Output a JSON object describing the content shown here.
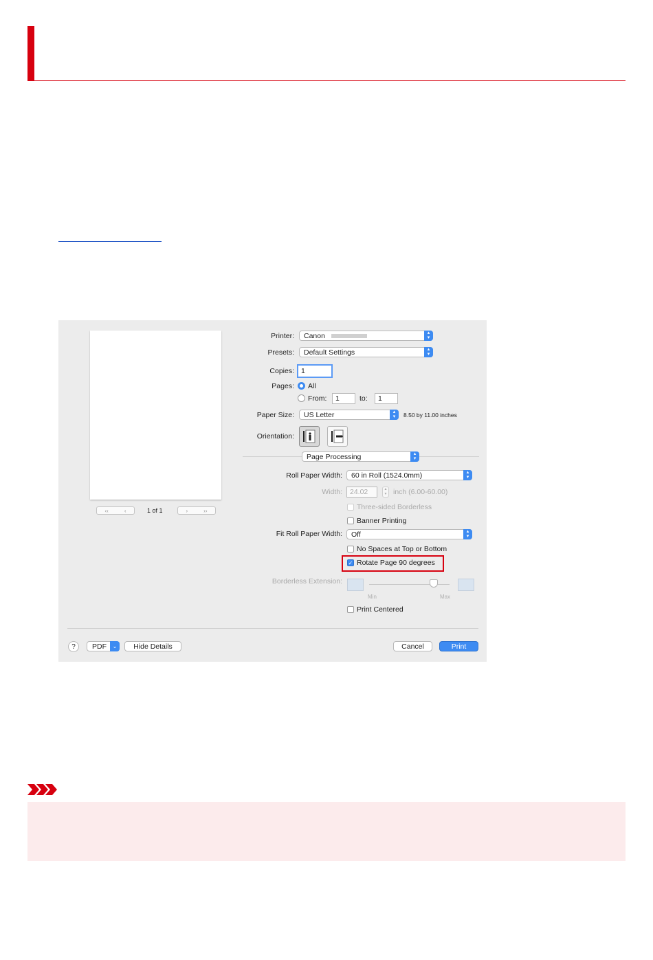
{
  "dialog": {
    "preview": {
      "page_counter": "1 of 1"
    },
    "printer": {
      "label": "Printer:",
      "value": "Canon"
    },
    "presets": {
      "label": "Presets:",
      "value": "Default Settings"
    },
    "copies": {
      "label": "Copies:",
      "value": "1"
    },
    "pages": {
      "label": "Pages:",
      "all_label": "All",
      "from_label": "From:",
      "from_value": "1",
      "to_label": "to:",
      "to_value": "1",
      "selected": "All"
    },
    "paper_size": {
      "label": "Paper Size:",
      "value": "US Letter",
      "info": "8.50 by 11.00 inches"
    },
    "orientation": {
      "label": "Orientation:",
      "selected": "portrait"
    },
    "section": {
      "value": "Page Processing"
    },
    "roll_paper_width": {
      "label": "Roll Paper Width:",
      "value": "60 in Roll (1524.0mm)"
    },
    "width": {
      "label": "Width:",
      "value": "24.02",
      "unit": "inch (6.00-60.00)"
    },
    "three_sided_borderless": {
      "label": "Three-sided Borderless",
      "checked": false,
      "enabled": false
    },
    "banner_printing": {
      "label": "Banner Printing",
      "checked": false
    },
    "fit_roll_paper_width": {
      "label": "Fit Roll Paper Width:",
      "value": "Off"
    },
    "no_spaces": {
      "label": "No Spaces at Top or Bottom",
      "checked": false
    },
    "rotate_page": {
      "label": "Rotate Page 90 degrees",
      "checked": true
    },
    "borderless_extension": {
      "label": "Borderless Extension:",
      "min_label": "Min",
      "max_label": "Max",
      "level": 0.8,
      "enabled": false
    },
    "print_centered": {
      "label": "Print Centered",
      "checked": false
    },
    "footer": {
      "help": "?",
      "pdf": "PDF",
      "hide_details": "Hide Details",
      "cancel": "Cancel",
      "print": "Print"
    }
  },
  "colors": {
    "accent": "#d7000f",
    "link": "#1a4fc4",
    "button_blue": "#3d8bf2",
    "note_bg": "#fcebec"
  }
}
